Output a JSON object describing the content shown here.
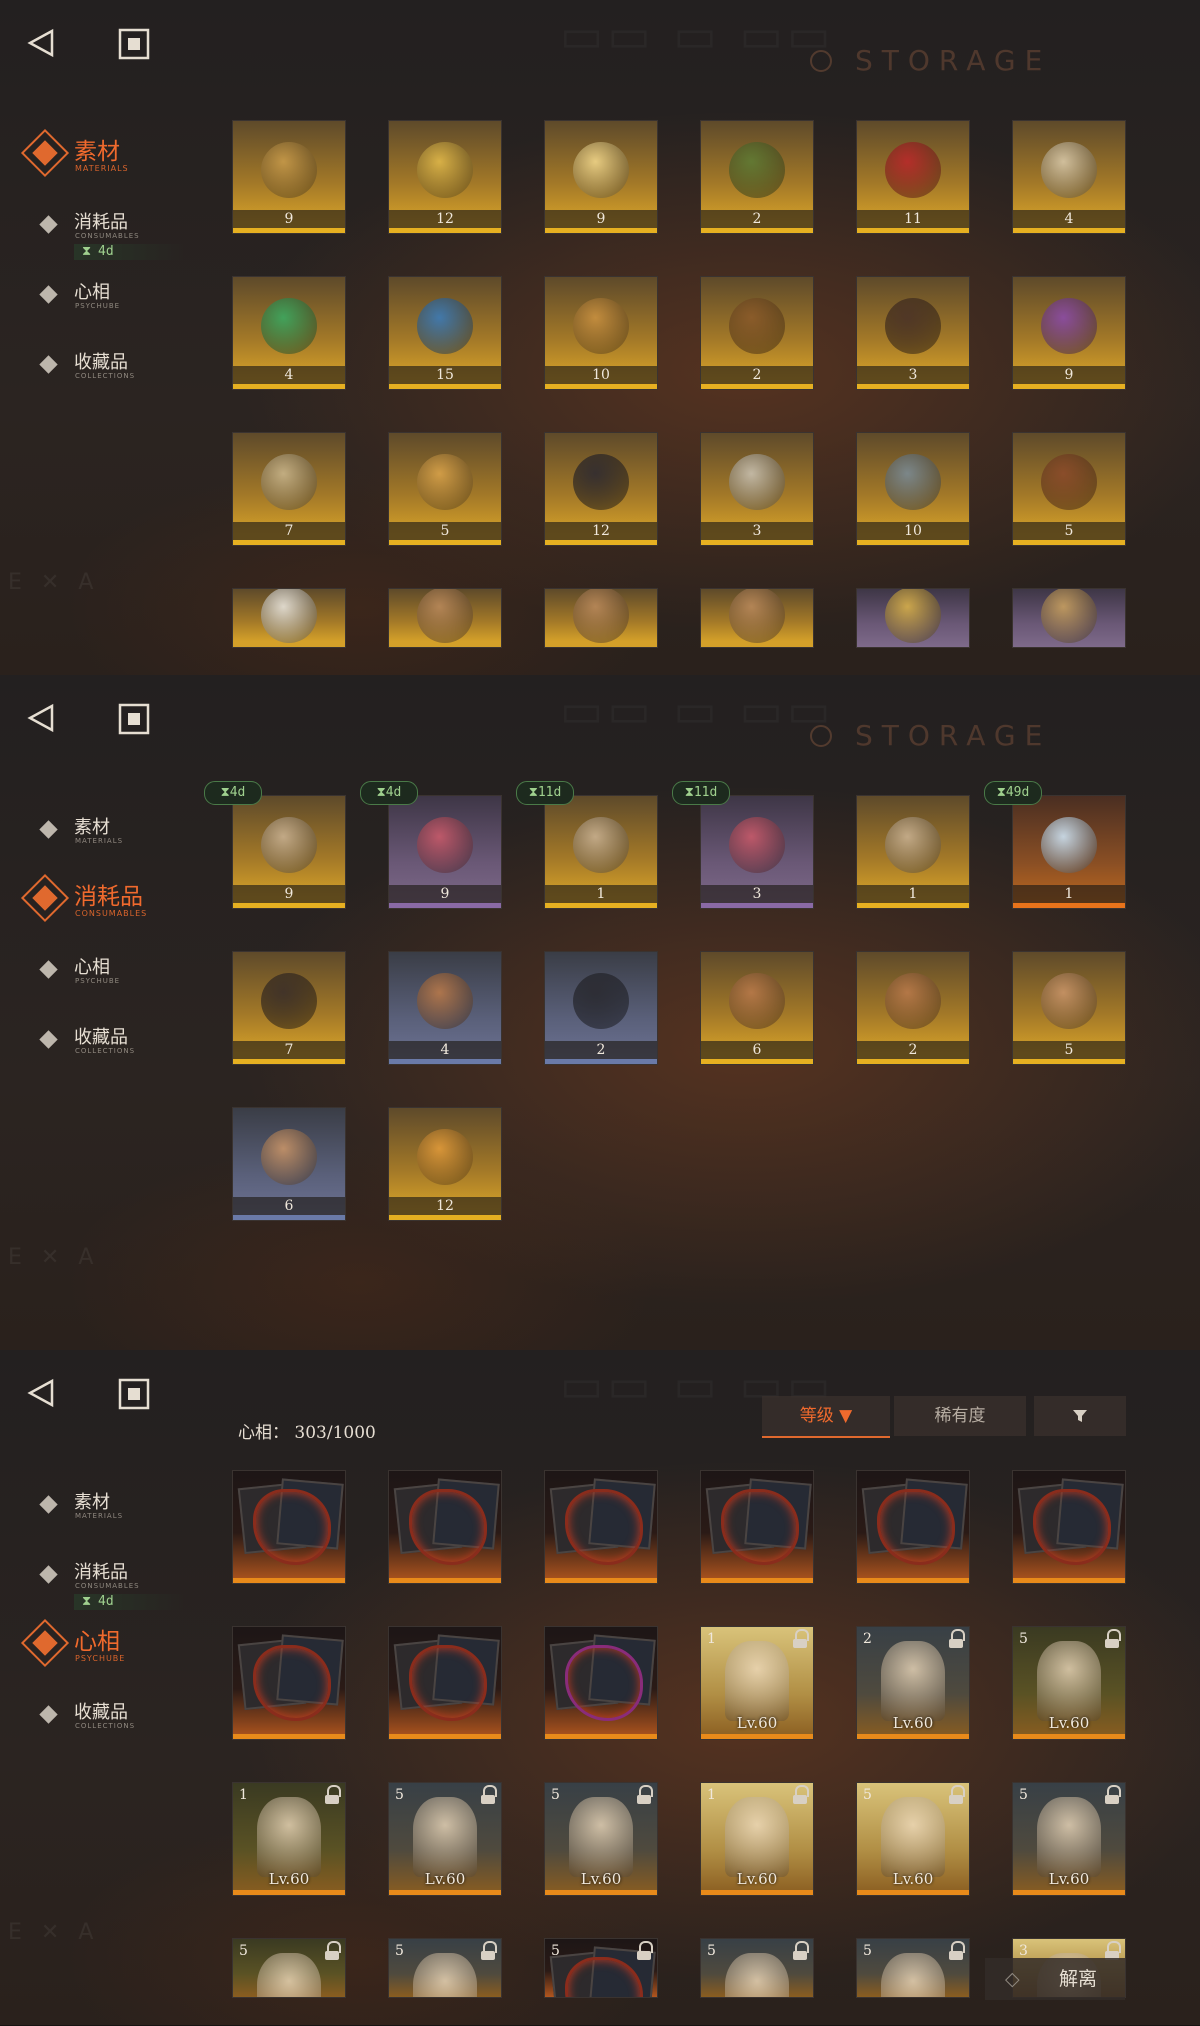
{
  "watermark": "STORAGE",
  "nav": {
    "items": [
      {
        "label": "素材",
        "sub": "MATERIALS"
      },
      {
        "label": "消耗品",
        "sub": "CONSUMABLES",
        "timer": "4d"
      },
      {
        "label": "心相",
        "sub": "PSYCHUBE"
      },
      {
        "label": "收藏品",
        "sub": "COLLECTIONS"
      }
    ]
  },
  "panels": [
    {
      "active_tab": 0,
      "items": [
        {
          "icon": "ring-bowl-icon",
          "qty": "9",
          "rarity": "gold"
        },
        {
          "icon": "caduceus-icon",
          "qty": "12",
          "rarity": "gold"
        },
        {
          "icon": "sheep-icon",
          "qty": "9",
          "rarity": "gold"
        },
        {
          "icon": "herb-sprig-icon",
          "qty": "2",
          "rarity": "gold"
        },
        {
          "icon": "apple-snake-icon",
          "qty": "11",
          "rarity": "gold"
        },
        {
          "icon": "open-book-icon",
          "qty": "4",
          "rarity": "gold"
        },
        {
          "icon": "green-rune-book-icon",
          "qty": "4",
          "rarity": "gold"
        },
        {
          "icon": "blue-rune-book-icon",
          "qty": "15",
          "rarity": "gold"
        },
        {
          "icon": "gold-rune-book-icon",
          "qty": "10",
          "rarity": "gold"
        },
        {
          "icon": "astrolabe-icon",
          "qty": "2",
          "rarity": "gold"
        },
        {
          "icon": "ouija-board-icon",
          "qty": "3",
          "rarity": "gold"
        },
        {
          "icon": "potion-bottle-icon",
          "qty": "9",
          "rarity": "gold"
        },
        {
          "icon": "pocket-watch-icon",
          "qty": "7",
          "rarity": "gold"
        },
        {
          "icon": "moth-icon",
          "qty": "5",
          "rarity": "gold"
        },
        {
          "icon": "dark-tome-icon",
          "qty": "12",
          "rarity": "gold"
        },
        {
          "icon": "bullets-icon",
          "qty": "3",
          "rarity": "gold"
        },
        {
          "icon": "bell-jar-icon",
          "qty": "10",
          "rarity": "gold"
        },
        {
          "icon": "box-icon",
          "qty": "5",
          "rarity": "gold"
        },
        {
          "icon": "ghost-icon",
          "qty": "",
          "rarity": "gold"
        },
        {
          "icon": "scroll-icon",
          "qty": "",
          "rarity": "gold"
        },
        {
          "icon": "scroll-icon",
          "qty": "",
          "rarity": "gold"
        },
        {
          "icon": "scroll-icon",
          "qty": "",
          "rarity": "gold"
        },
        {
          "icon": "pendant-icon",
          "qty": "",
          "rarity": "purple"
        },
        {
          "icon": "saxophone-icon",
          "qty": "",
          "rarity": "purple"
        }
      ]
    },
    {
      "active_tab": 1,
      "items": [
        {
          "icon": "candy-jar-icon",
          "qty": "9",
          "rarity": "gold",
          "timer": "4d"
        },
        {
          "icon": "lollipop-icon",
          "qty": "9",
          "rarity": "purple",
          "timer": "4d"
        },
        {
          "icon": "candy-jar-icon",
          "qty": "1",
          "rarity": "gold",
          "timer": "11d"
        },
        {
          "icon": "lollipop-icon",
          "qty": "3",
          "rarity": "purple",
          "timer": "11d"
        },
        {
          "icon": "candy-jar-icon",
          "qty": "1",
          "rarity": "gold",
          "timer": ""
        },
        {
          "icon": "crystal-icon",
          "qty": "1",
          "rarity": "orange",
          "timer": "49d"
        },
        {
          "icon": "rune-crate-icon",
          "qty": "7",
          "rarity": "gold",
          "timer": ""
        },
        {
          "icon": "wooden-crate-icon",
          "qty": "4",
          "rarity": "blue",
          "timer": ""
        },
        {
          "icon": "bottle-icon",
          "qty": "2",
          "rarity": "blue",
          "timer": ""
        },
        {
          "icon": "wooden-crate-icon",
          "qty": "6",
          "rarity": "gold",
          "timer": ""
        },
        {
          "icon": "wooden-crate-icon",
          "qty": "2",
          "rarity": "gold",
          "timer": ""
        },
        {
          "icon": "bundle-icon",
          "qty": "5",
          "rarity": "gold",
          "timer": ""
        },
        {
          "icon": "bundle-icon",
          "qty": "6",
          "rarity": "blue",
          "timer": ""
        },
        {
          "icon": "rabbit-box-icon",
          "qty": "12",
          "rarity": "gold",
          "timer": ""
        }
      ]
    },
    {
      "active_tab": 2,
      "count_label": "心相：",
      "count_value": "303/1000",
      "sort": {
        "level": "等级 ▼",
        "rarity": "稀有度",
        "filter": "filter-icon"
      },
      "release_label": "解离",
      "cards": [
        {
          "type": "fire",
          "ins": "",
          "lv": "",
          "lock": false
        },
        {
          "type": "fire",
          "ins": "",
          "lv": "",
          "lock": false
        },
        {
          "type": "fire",
          "ins": "",
          "lv": "",
          "lock": false
        },
        {
          "type": "fire",
          "ins": "",
          "lv": "",
          "lock": false
        },
        {
          "type": "fire",
          "ins": "",
          "lv": "",
          "lock": false
        },
        {
          "type": "fire",
          "ins": "",
          "lv": "",
          "lock": false
        },
        {
          "type": "fire",
          "ins": "",
          "lv": "",
          "lock": false
        },
        {
          "type": "fire",
          "ins": "",
          "lv": "",
          "lock": false
        },
        {
          "type": "fire",
          "ins": "",
          "lv": "",
          "lock": false
        },
        {
          "type": "char-y",
          "ins": "1",
          "lv": "Lv.60",
          "lock": true
        },
        {
          "type": "char-d",
          "ins": "2",
          "lv": "Lv.60",
          "lock": true
        },
        {
          "type": "char-g",
          "ins": "5",
          "lv": "Lv.60",
          "lock": true
        },
        {
          "type": "char-g",
          "ins": "1",
          "lv": "Lv.60",
          "lock": true
        },
        {
          "type": "char-d",
          "ins": "5",
          "lv": "Lv.60",
          "lock": true
        },
        {
          "type": "char-d",
          "ins": "5",
          "lv": "Lv.60",
          "lock": true
        },
        {
          "type": "char-y",
          "ins": "1",
          "lv": "Lv.60",
          "lock": true
        },
        {
          "type": "char-y",
          "ins": "5",
          "lv": "Lv.60",
          "lock": true
        },
        {
          "type": "char-d",
          "ins": "5",
          "lv": "Lv.60",
          "lock": true
        },
        {
          "type": "char-g",
          "ins": "5",
          "lv": "",
          "lock": true
        },
        {
          "type": "char-d",
          "ins": "5",
          "lv": "",
          "lock": true
        },
        {
          "type": "fire",
          "ins": "5",
          "lv": "",
          "lock": true
        },
        {
          "type": "char-d",
          "ins": "5",
          "lv": "",
          "lock": true
        },
        {
          "type": "char-d",
          "ins": "5",
          "lv": "",
          "lock": true
        },
        {
          "type": "char-y",
          "ins": "3",
          "lv": "",
          "lock": true
        }
      ]
    }
  ]
}
